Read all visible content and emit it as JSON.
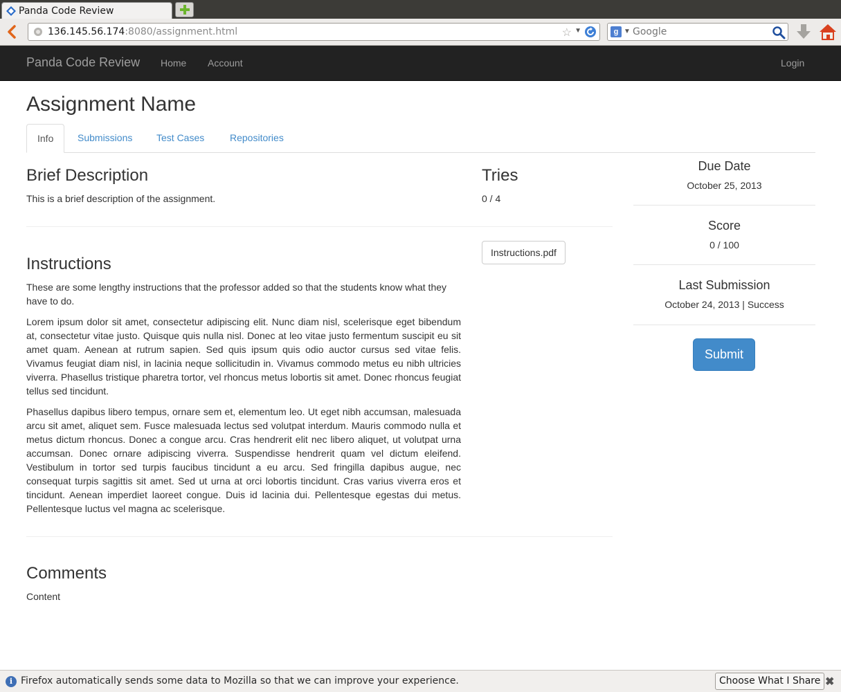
{
  "browser": {
    "tab_title": "Panda Code Review",
    "url_host": "136.145.56.174",
    "url_rest": ":8080/assignment.html",
    "search_placeholder": "Google",
    "search_engine_letter": "g",
    "notification": "Firefox automatically sends some data to Mozilla so that we can improve your experience.",
    "notification_button": "Choose What I Share"
  },
  "navbar": {
    "brand": "Panda Code Review",
    "home": "Home",
    "account": "Account",
    "login": "Login"
  },
  "page": {
    "title": "Assignment Name",
    "tabs": [
      "Info",
      "Submissions",
      "Test Cases",
      "Repositories"
    ]
  },
  "brief": {
    "heading": "Brief Description",
    "text": "This is a brief description of the assignment."
  },
  "tries": {
    "heading": "Tries",
    "value": "0 / 4"
  },
  "instructions": {
    "heading": "Instructions",
    "p1": "These are some lengthy instructions that the professor added so that the students know what they have to do.",
    "p2": "Lorem ipsum dolor sit amet, consectetur adipiscing elit. Nunc diam nisl, scelerisque eget bibendum at, consectetur vitae justo. Quisque quis nulla nisl. Donec at leo vitae justo fermentum suscipit eu sit amet quam. Aenean at rutrum sapien. Sed quis ipsum quis odio auctor cursus sed vitae felis. Vivamus feugiat diam nisl, in lacinia neque sollicitudin in. Vivamus commodo metus eu nibh ultricies viverra. Phasellus tristique pharetra tortor, vel rhoncus metus lobortis sit amet. Donec rhoncus feugiat tellus sed tincidunt.",
    "p3": "Phasellus dapibus libero tempus, ornare sem et, elementum leo. Ut eget nibh accumsan, malesuada arcu sit amet, aliquet sem. Fusce malesuada lectus sed volutpat interdum. Mauris commodo nulla et metus dictum rhoncus. Donec a congue arcu. Cras hendrerit elit nec libero aliquet, ut volutpat urna accumsan. Donec ornare adipiscing viverra. Suspendisse hendrerit quam vel dictum eleifend. Vestibulum in tortor sed turpis faucibus tincidunt a eu arcu. Sed fringilla dapibus augue, nec consequat turpis sagittis sit amet. Sed ut urna at orci lobortis tincidunt. Cras varius viverra eros et tincidunt. Aenean imperdiet laoreet congue. Duis id lacinia dui. Pellentesque egestas dui metus. Pellentesque luctus vel magna ac scelerisque.",
    "attachment": "Instructions.pdf"
  },
  "comments": {
    "heading": "Comments",
    "content": "Content"
  },
  "sidebar": {
    "due_label": "Due Date",
    "due_value": "October 25, 2013",
    "score_label": "Score",
    "score_value": "0 / 100",
    "last_label": "Last Submission",
    "last_value": "October 24, 2013 | Success",
    "submit": "Submit"
  },
  "colors": {
    "navbar_bg": "#222222",
    "link": "#428bca",
    "primary_button": "#428bca"
  }
}
